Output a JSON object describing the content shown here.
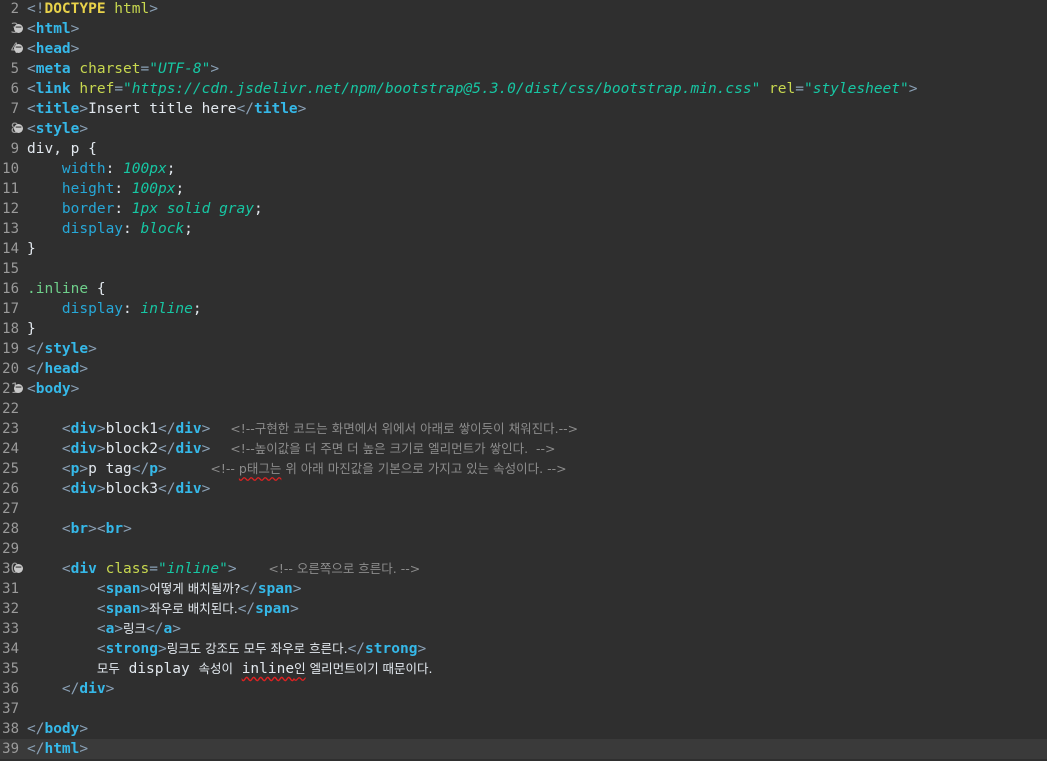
{
  "editor": {
    "lines": [
      {
        "num": "2",
        "fold": false,
        "tokens": [
          {
            "t": "<!",
            "c": "punct"
          },
          {
            "t": "DOCTYPE",
            "c": "doctype"
          },
          {
            "t": " html",
            "c": "attr"
          },
          {
            "t": ">",
            "c": "punct"
          }
        ]
      },
      {
        "num": "3",
        "fold": true,
        "tokens": [
          {
            "t": "<",
            "c": "punct"
          },
          {
            "t": "html",
            "c": "tag"
          },
          {
            "t": ">",
            "c": "punct"
          }
        ]
      },
      {
        "num": "4",
        "fold": true,
        "tokens": [
          {
            "t": "<",
            "c": "punct"
          },
          {
            "t": "head",
            "c": "tag"
          },
          {
            "t": ">",
            "c": "punct"
          }
        ]
      },
      {
        "num": "5",
        "fold": false,
        "tokens": [
          {
            "t": "<",
            "c": "punct"
          },
          {
            "t": "meta",
            "c": "tag"
          },
          {
            "t": " charset",
            "c": "attr"
          },
          {
            "t": "=",
            "c": "punct"
          },
          {
            "t": "\"UTF-8\"",
            "c": "val"
          },
          {
            "t": ">",
            "c": "punct"
          }
        ]
      },
      {
        "num": "6",
        "fold": false,
        "tokens": [
          {
            "t": "<",
            "c": "punct"
          },
          {
            "t": "link",
            "c": "tag"
          },
          {
            "t": " href",
            "c": "attr"
          },
          {
            "t": "=",
            "c": "punct"
          },
          {
            "t": "\"https://cdn.jsdelivr.net/npm/bootstrap@5.3.0/dist/css/bootstrap.min.css\"",
            "c": "val"
          },
          {
            "t": " rel",
            "c": "attr"
          },
          {
            "t": "=",
            "c": "punct"
          },
          {
            "t": "\"stylesheet\"",
            "c": "val"
          },
          {
            "t": ">",
            "c": "punct"
          }
        ]
      },
      {
        "num": "7",
        "fold": false,
        "tokens": [
          {
            "t": "<",
            "c": "punct"
          },
          {
            "t": "title",
            "c": "tag"
          },
          {
            "t": ">",
            "c": "punct"
          },
          {
            "t": "Insert title here",
            "c": "text"
          },
          {
            "t": "</",
            "c": "punct"
          },
          {
            "t": "title",
            "c": "tag"
          },
          {
            "t": ">",
            "c": "punct"
          }
        ]
      },
      {
        "num": "8",
        "fold": true,
        "tokens": [
          {
            "t": "<",
            "c": "punct"
          },
          {
            "t": "style",
            "c": "tag"
          },
          {
            "t": ">",
            "c": "punct"
          }
        ]
      },
      {
        "num": "9",
        "fold": false,
        "tokens": [
          {
            "t": "div, p {",
            "c": "sel"
          }
        ]
      },
      {
        "num": "10",
        "fold": false,
        "tokens": [
          {
            "t": "    width",
            "c": "prop"
          },
          {
            "t": ": ",
            "c": "plain"
          },
          {
            "t": "100px",
            "c": "pval"
          },
          {
            "t": ";",
            "c": "plain"
          }
        ]
      },
      {
        "num": "11",
        "fold": false,
        "tokens": [
          {
            "t": "    height",
            "c": "prop"
          },
          {
            "t": ": ",
            "c": "plain"
          },
          {
            "t": "100px",
            "c": "pval"
          },
          {
            "t": ";",
            "c": "plain"
          }
        ]
      },
      {
        "num": "12",
        "fold": false,
        "tokens": [
          {
            "t": "    border",
            "c": "prop"
          },
          {
            "t": ": ",
            "c": "plain"
          },
          {
            "t": "1px solid gray",
            "c": "pval"
          },
          {
            "t": ";",
            "c": "plain"
          }
        ]
      },
      {
        "num": "13",
        "fold": false,
        "tokens": [
          {
            "t": "    display",
            "c": "prop"
          },
          {
            "t": ": ",
            "c": "plain"
          },
          {
            "t": "block",
            "c": "pval"
          },
          {
            "t": ";",
            "c": "plain"
          }
        ]
      },
      {
        "num": "14",
        "fold": false,
        "tokens": [
          {
            "t": "}",
            "c": "plain"
          }
        ]
      },
      {
        "num": "15",
        "fold": false,
        "tokens": []
      },
      {
        "num": "16",
        "fold": false,
        "tokens": [
          {
            "t": ".inline",
            "c": "class"
          },
          {
            "t": " {",
            "c": "plain"
          }
        ]
      },
      {
        "num": "17",
        "fold": false,
        "tokens": [
          {
            "t": "    display",
            "c": "prop"
          },
          {
            "t": ": ",
            "c": "plain"
          },
          {
            "t": "inline",
            "c": "pval"
          },
          {
            "t": ";",
            "c": "plain"
          }
        ]
      },
      {
        "num": "18",
        "fold": false,
        "tokens": [
          {
            "t": "}",
            "c": "plain"
          }
        ]
      },
      {
        "num": "19",
        "fold": false,
        "tokens": [
          {
            "t": "</",
            "c": "punct"
          },
          {
            "t": "style",
            "c": "tag"
          },
          {
            "t": ">",
            "c": "punct"
          }
        ]
      },
      {
        "num": "20",
        "fold": false,
        "tokens": [
          {
            "t": "</",
            "c": "punct"
          },
          {
            "t": "head",
            "c": "tag"
          },
          {
            "t": ">",
            "c": "punct"
          }
        ]
      },
      {
        "num": "21",
        "fold": true,
        "tokens": [
          {
            "t": "<",
            "c": "punct"
          },
          {
            "t": "body",
            "c": "tag"
          },
          {
            "t": ">",
            "c": "punct"
          }
        ]
      },
      {
        "num": "22",
        "fold": false,
        "tokens": []
      },
      {
        "num": "23",
        "fold": false,
        "tokens": [
          {
            "t": "    <",
            "c": "punct"
          },
          {
            "t": "div",
            "c": "tag"
          },
          {
            "t": ">",
            "c": "punct"
          },
          {
            "t": "block1",
            "c": "text"
          },
          {
            "t": "</",
            "c": "punct"
          },
          {
            "t": "div",
            "c": "tag"
          },
          {
            "t": ">",
            "c": "punct"
          },
          {
            "t": "     <!--구현한 코드는 화면에서 위에서 아래로 쌓이듯이 채워진다.-->",
            "c": "comment"
          }
        ]
      },
      {
        "num": "24",
        "fold": false,
        "tokens": [
          {
            "t": "    <",
            "c": "punct"
          },
          {
            "t": "div",
            "c": "tag"
          },
          {
            "t": ">",
            "c": "punct"
          },
          {
            "t": "block2",
            "c": "text"
          },
          {
            "t": "</",
            "c": "punct"
          },
          {
            "t": "div",
            "c": "tag"
          },
          {
            "t": ">",
            "c": "punct"
          },
          {
            "t": "     <!--높이값을 더 주면 더 높은 크기로 엘리먼트가 쌓인다.  -->",
            "c": "comment"
          }
        ]
      },
      {
        "num": "25",
        "fold": false,
        "tokens": [
          {
            "t": "    <",
            "c": "punct"
          },
          {
            "t": "p",
            "c": "tag"
          },
          {
            "t": ">",
            "c": "punct"
          },
          {
            "t": "p tag",
            "c": "text"
          },
          {
            "t": "</",
            "c": "punct"
          },
          {
            "t": "p",
            "c": "tag"
          },
          {
            "t": ">",
            "c": "punct"
          },
          {
            "t": "           <!-- ",
            "c": "comment"
          },
          {
            "t": "p태그는",
            "c": "comment-sq"
          },
          {
            "t": " 위 아래 마진값을 기본으로 가지고 있는 속성이다. -->",
            "c": "comment"
          }
        ]
      },
      {
        "num": "26",
        "fold": false,
        "tokens": [
          {
            "t": "    <",
            "c": "punct"
          },
          {
            "t": "div",
            "c": "tag"
          },
          {
            "t": ">",
            "c": "punct"
          },
          {
            "t": "block3",
            "c": "text"
          },
          {
            "t": "</",
            "c": "punct"
          },
          {
            "t": "div",
            "c": "tag"
          },
          {
            "t": ">",
            "c": "punct"
          }
        ]
      },
      {
        "num": "27",
        "fold": false,
        "tokens": []
      },
      {
        "num": "28",
        "fold": false,
        "tokens": [
          {
            "t": "    <",
            "c": "punct"
          },
          {
            "t": "br",
            "c": "tag"
          },
          {
            "t": "><",
            "c": "punct"
          },
          {
            "t": "br",
            "c": "tag"
          },
          {
            "t": ">",
            "c": "punct"
          }
        ]
      },
      {
        "num": "29",
        "fold": false,
        "tokens": []
      },
      {
        "num": "30",
        "fold": true,
        "tokens": [
          {
            "t": "    <",
            "c": "punct"
          },
          {
            "t": "div",
            "c": "tag"
          },
          {
            "t": " class",
            "c": "attr"
          },
          {
            "t": "=",
            "c": "punct"
          },
          {
            "t": "\"inline\"",
            "c": "val"
          },
          {
            "t": ">",
            "c": "punct"
          },
          {
            "t": "        <!-- 오른쪽으로 흐른다. -->",
            "c": "comment"
          }
        ]
      },
      {
        "num": "31",
        "fold": false,
        "tokens": [
          {
            "t": "        <",
            "c": "punct"
          },
          {
            "t": "span",
            "c": "tag"
          },
          {
            "t": ">",
            "c": "punct"
          },
          {
            "t": "어떻게 배치될까?",
            "c": "text-kr"
          },
          {
            "t": "</",
            "c": "punct"
          },
          {
            "t": "span",
            "c": "tag"
          },
          {
            "t": ">",
            "c": "punct"
          }
        ]
      },
      {
        "num": "32",
        "fold": false,
        "tokens": [
          {
            "t": "        <",
            "c": "punct"
          },
          {
            "t": "span",
            "c": "tag"
          },
          {
            "t": ">",
            "c": "punct"
          },
          {
            "t": "좌우로 배치된다.",
            "c": "text-kr"
          },
          {
            "t": "</",
            "c": "punct"
          },
          {
            "t": "span",
            "c": "tag"
          },
          {
            "t": ">",
            "c": "punct"
          }
        ]
      },
      {
        "num": "33",
        "fold": false,
        "tokens": [
          {
            "t": "        <",
            "c": "punct"
          },
          {
            "t": "a",
            "c": "tag"
          },
          {
            "t": ">",
            "c": "punct"
          },
          {
            "t": "링크",
            "c": "text-kr"
          },
          {
            "t": "</",
            "c": "punct"
          },
          {
            "t": "a",
            "c": "tag"
          },
          {
            "t": ">",
            "c": "punct"
          }
        ]
      },
      {
        "num": "34",
        "fold": false,
        "tokens": [
          {
            "t": "        <",
            "c": "punct"
          },
          {
            "t": "strong",
            "c": "tag"
          },
          {
            "t": ">",
            "c": "punct"
          },
          {
            "t": "링크도 강조도 모두 좌우로 흐른다.",
            "c": "text-kr"
          },
          {
            "t": "</",
            "c": "punct"
          },
          {
            "t": "strong",
            "c": "tag"
          },
          {
            "t": ">",
            "c": "punct"
          }
        ]
      },
      {
        "num": "35",
        "fold": false,
        "tokens": [
          {
            "t": "        ",
            "c": "plain"
          },
          {
            "t": "모두",
            "c": "text-kr"
          },
          {
            "t": " display ",
            "c": "text"
          },
          {
            "t": "속성이",
            "c": "text-kr"
          },
          {
            "t": " ",
            "c": "text"
          },
          {
            "t": "inline",
            "c": "text-sq"
          },
          {
            "t": "인",
            "c": "text-kr-sq"
          },
          {
            "t": " 엘리먼트이기 때문이다.",
            "c": "text-kr"
          }
        ]
      },
      {
        "num": "36",
        "fold": false,
        "tokens": [
          {
            "t": "    </",
            "c": "punct"
          },
          {
            "t": "div",
            "c": "tag"
          },
          {
            "t": ">",
            "c": "punct"
          }
        ]
      },
      {
        "num": "37",
        "fold": false,
        "tokens": []
      },
      {
        "num": "38",
        "fold": false,
        "tokens": [
          {
            "t": "</",
            "c": "punct"
          },
          {
            "t": "body",
            "c": "tag"
          },
          {
            "t": ">",
            "c": "punct"
          }
        ]
      },
      {
        "num": "39",
        "fold": false,
        "current": true,
        "tokens": [
          {
            "t": "</",
            "c": "punct"
          },
          {
            "t": "html",
            "c": "tag"
          },
          {
            "t": ">",
            "c": "punct"
          }
        ]
      }
    ]
  }
}
